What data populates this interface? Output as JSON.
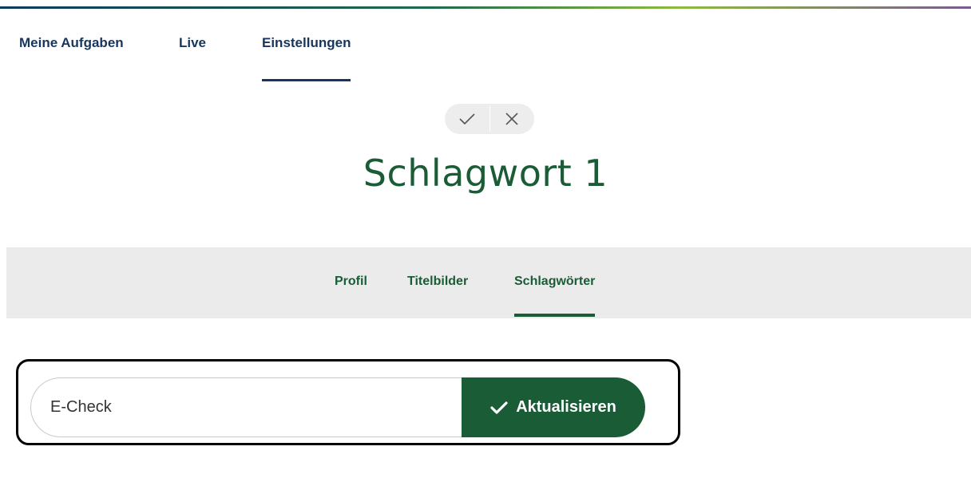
{
  "top_nav": {
    "tabs": [
      {
        "label": "Meine Aufgaben"
      },
      {
        "label": "Live"
      },
      {
        "label": "Einstellungen",
        "active": true
      }
    ]
  },
  "approval": {
    "confirm_icon": "check-icon",
    "cancel_icon": "close-icon"
  },
  "page": {
    "title": "Schlagwort 1"
  },
  "sub_nav": {
    "tabs": [
      {
        "label": "Profil"
      },
      {
        "label": "Titelbilder"
      },
      {
        "label": "Schlagwörter",
        "active": true
      }
    ]
  },
  "keyword_form": {
    "input_value": "E-Check",
    "button_label": "Aktualisieren",
    "button_icon": "check-icon"
  },
  "colors": {
    "primary_green": "#1a5c36",
    "navy": "#17365d",
    "subnav_bg": "#ebebeb"
  }
}
